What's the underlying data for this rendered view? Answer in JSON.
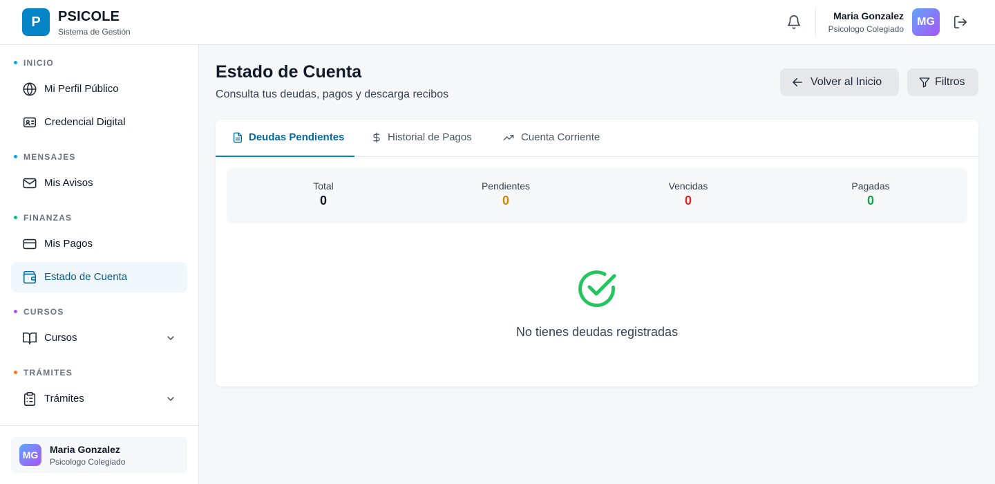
{
  "header": {
    "logo_letter": "P",
    "brand_name": "PSICOLE",
    "brand_subtitle": "Sistema de Gestión",
    "user_name": "Maria Gonzalez",
    "user_role": "Psicologo Colegiado",
    "avatar_initials": "MG"
  },
  "sidebar": {
    "sections": {
      "inicio": "INICIO",
      "mensajes": "MENSAJES",
      "finanzas": "FINANZAS",
      "cursos": "CURSOS",
      "tramites": "TRÁMITES"
    },
    "section_colors": {
      "inicio": "#0ea5e9",
      "mensajes": "#0ea5e9",
      "finanzas": "#10b981",
      "cursos": "#a855f7",
      "tramites": "#f97316"
    },
    "items": {
      "perfil": "Mi Perfil Público",
      "credencial": "Credencial Digital",
      "avisos": "Mis Avisos",
      "pagos": "Mis Pagos",
      "estado": "Estado de Cuenta",
      "cursos": "Cursos",
      "tramites": "Trámites"
    },
    "user": {
      "name": "Maria Gonzalez",
      "role": "Psicologo Colegiado",
      "initials": "MG"
    }
  },
  "main": {
    "title": "Estado de Cuenta",
    "subtitle": "Consulta tus deudas, pagos y descarga recibos",
    "back_button": "Volver al Inicio",
    "filter_button": "Filtros",
    "tabs": {
      "deudas": "Deudas Pendientes",
      "historial": "Historial de Pagos",
      "corriente": "Cuenta Corriente"
    },
    "stats": {
      "total_label": "Total",
      "total_value": "0",
      "pendientes_label": "Pendientes",
      "pendientes_value": "0",
      "vencidas_label": "Vencidas",
      "vencidas_value": "0",
      "pagadas_label": "Pagadas",
      "pagadas_value": "0"
    },
    "stat_colors": {
      "total": "#111827",
      "pendientes": "#ca8a04",
      "vencidas": "#dc2626",
      "pagadas": "#16a34a"
    },
    "empty_message": "No tienes deudas registradas"
  }
}
